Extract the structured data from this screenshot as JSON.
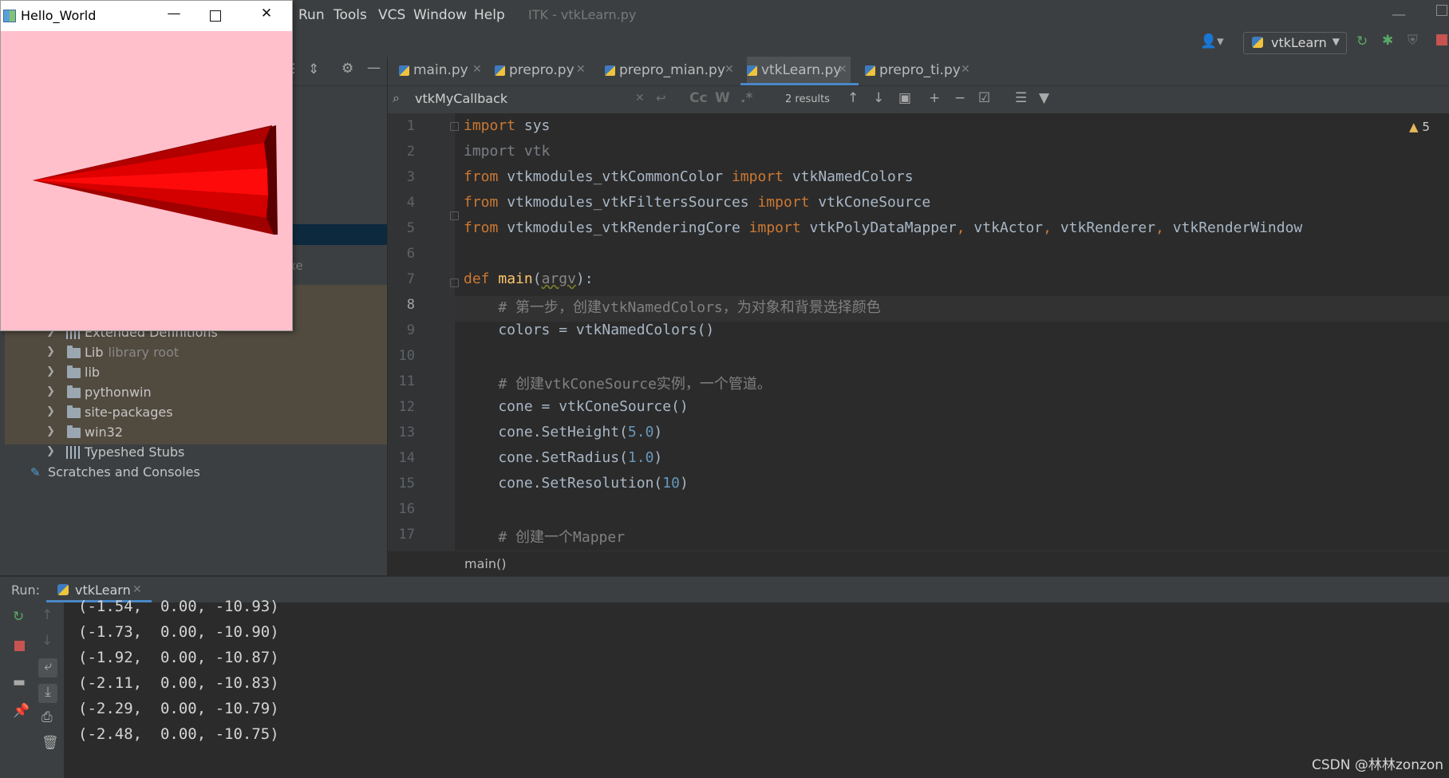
{
  "menu": {
    "items": [
      "Run",
      "Tools",
      "VCS",
      "Window",
      "Help"
    ],
    "window_title": "ITK - vtkLearn.py"
  },
  "toolbar": {
    "run_config": "vtkLearn",
    "user_icon": "user-icon",
    "rerun_icon": "rerun-icon",
    "debug_icon": "debug-icon",
    "stop_icon": "stop-icon"
  },
  "popup_window": {
    "title": "Hello_World",
    "background_color": "#ffc0cb",
    "cone_color": "#ff0000"
  },
  "project_tree": {
    "items": [
      {
        "label": "Extended Definitions",
        "type": "library"
      },
      {
        "label": "Lib",
        "sub": "library root",
        "type": "folder"
      },
      {
        "label": "lib",
        "type": "folder"
      },
      {
        "label": "pythonwin",
        "type": "folder"
      },
      {
        "label": "site-packages",
        "type": "folder"
      },
      {
        "label": "win32",
        "type": "folder"
      },
      {
        "label": "Typeshed Stubs",
        "type": "library"
      }
    ],
    "scratches": "Scratches and Consoles",
    "partial_text": "xe"
  },
  "editor_tabs": [
    {
      "label": "main.py",
      "active": false
    },
    {
      "label": "prepro.py",
      "active": false
    },
    {
      "label": "prepro_mian.py",
      "active": false
    },
    {
      "label": "vtkLearn.py",
      "active": true
    },
    {
      "label": "prepro_ti.py",
      "active": false
    }
  ],
  "find_bar": {
    "query": "vtkMyCallback",
    "case_label": "Cc",
    "word_label": "W",
    "regex_label": ".*",
    "results": "2 results"
  },
  "editor": {
    "warnings_count": "5",
    "current_line": 8,
    "line_numbers": [
      "1",
      "2",
      "3",
      "4",
      "5",
      "6",
      "7",
      "8",
      "9",
      "10",
      "11",
      "12",
      "13",
      "14",
      "15",
      "16",
      "17"
    ],
    "breadcrumb": "main()"
  },
  "run_panel": {
    "label": "Run:",
    "tab": "vtkLearn",
    "output_lines": [
      "(-1.54,  0.00, -10.93)",
      "(-1.73,  0.00, -10.90)",
      "(-1.92,  0.00, -10.87)",
      "(-2.11,  0.00, -10.83)",
      "(-2.29,  0.00, -10.79)",
      "(-2.48,  0.00, -10.75)"
    ]
  },
  "watermark": "CSDN @林林zonzon",
  "colors": {
    "keyword": "#cc7832",
    "number": "#6897bb",
    "comment": "#808080",
    "function": "#ffc66d",
    "tab_underline": "#4a88c7"
  }
}
